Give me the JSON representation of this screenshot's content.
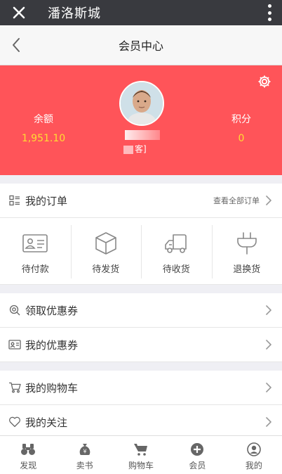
{
  "window": {
    "title": "潘洛斯城"
  },
  "nav": {
    "title": "会员中心"
  },
  "profile": {
    "balance_label": "余额",
    "balance_value": "1,951.10",
    "points_label": "积分",
    "points_value": "0",
    "level_suffix": "客]"
  },
  "orders": {
    "header_label": "我的订单",
    "view_all_label": "查看全部订单",
    "items": [
      {
        "label": "待付款",
        "icon": "payment-card-icon"
      },
      {
        "label": "待发货",
        "icon": "package-box-icon"
      },
      {
        "label": "待收货",
        "icon": "delivery-truck-icon"
      },
      {
        "label": "退换货",
        "icon": "plug-icon"
      }
    ]
  },
  "coupons": {
    "get_label": "领取优惠券",
    "mine_label": "我的优惠券"
  },
  "shopping": {
    "cart_label": "我的购物车",
    "follow_label": "我的关注"
  },
  "tabbar": [
    {
      "label": "发现",
      "icon": "binoculars-icon"
    },
    {
      "label": "卖书",
      "icon": "money-bag-icon"
    },
    {
      "label": "购物车",
      "icon": "cart-icon"
    },
    {
      "label": "会员",
      "icon": "plus-circle-icon"
    },
    {
      "label": "我的",
      "icon": "user-circle-icon"
    }
  ],
  "colors": {
    "header_bg": "#393a3f",
    "profile_bg": "#ff5459",
    "value_yellow": "#ffdd33"
  }
}
